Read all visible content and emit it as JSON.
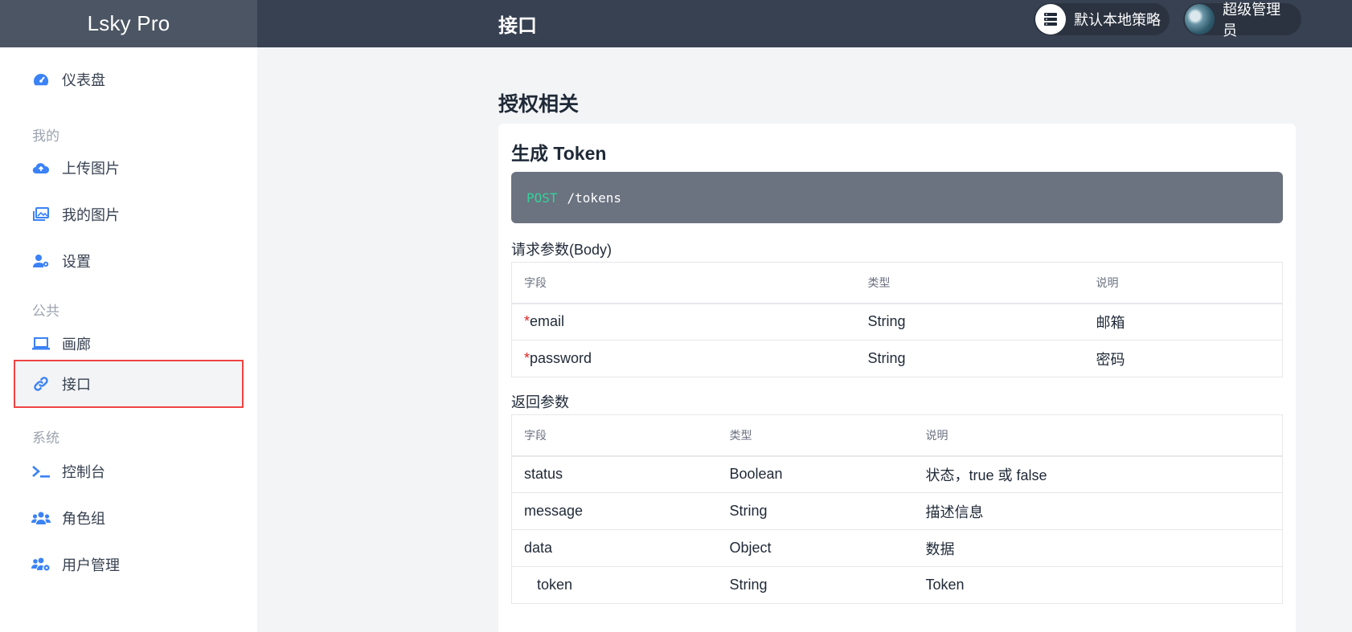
{
  "app": {
    "brand": "Lsky Pro",
    "page_title": "接口"
  },
  "header": {
    "strategy_label": "默认本地策略",
    "user_label": "超级管理员"
  },
  "sidebar": {
    "items": [
      {
        "label": "仪表盘",
        "icon": "dashboard-icon"
      },
      {
        "label": "上传图片",
        "icon": "cloud-upload-icon"
      },
      {
        "label": "我的图片",
        "icon": "images-icon"
      },
      {
        "label": "设置",
        "icon": "user-gear-icon"
      },
      {
        "label": "画廊",
        "icon": "laptop-icon"
      },
      {
        "label": "接口",
        "icon": "link-icon"
      },
      {
        "label": "控制台",
        "icon": "terminal-icon"
      },
      {
        "label": "角色组",
        "icon": "users-icon"
      },
      {
        "label": "用户管理",
        "icon": "users-gear-icon"
      }
    ],
    "sections": {
      "mine": "我的",
      "public": "公共",
      "system": "系统"
    }
  },
  "main": {
    "section_heading": "授权相关",
    "card_title": "生成 Token",
    "endpoint": {
      "method": "POST",
      "path": "/tokens"
    },
    "request_label": "请求参数(Body)",
    "request_table": {
      "headers": [
        "字段",
        "类型",
        "说明"
      ],
      "rows": [
        {
          "field": "email",
          "type": "String",
          "desc": "邮箱",
          "required_mark": "*"
        },
        {
          "field": "password",
          "type": "String",
          "desc": "密码",
          "required_mark": "*"
        }
      ]
    },
    "response_label": "返回参数",
    "response_table": {
      "headers": [
        "字段",
        "类型",
        "说明"
      ],
      "rows": [
        {
          "field": "status",
          "type": "Boolean",
          "desc": "状态，true 或 false"
        },
        {
          "field": "message",
          "type": "String",
          "desc": "描述信息"
        },
        {
          "field": "data",
          "type": "Object",
          "desc": "数据"
        },
        {
          "field": "token",
          "type": "String",
          "desc": "Token"
        }
      ]
    }
  },
  "colors": {
    "accent": "#3b82f6",
    "highlight_border": "#ef4444",
    "topbar": "#374151",
    "method_green": "#34d399"
  }
}
